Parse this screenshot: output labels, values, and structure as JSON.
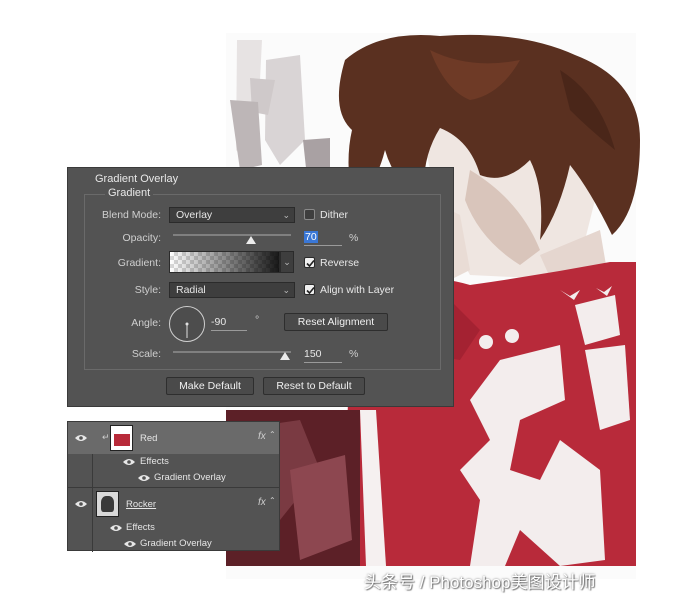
{
  "gradient_overlay": {
    "title": "Gradient Overlay",
    "group_title": "Gradient",
    "blend_mode": {
      "label": "Blend Mode:",
      "value": "Overlay"
    },
    "dither": {
      "label": "Dither",
      "checked": false
    },
    "opacity": {
      "label": "Opacity:",
      "value": "70",
      "unit": "%"
    },
    "gradient": {
      "label": "Gradient:"
    },
    "reverse": {
      "label": "Reverse",
      "checked": true
    },
    "style": {
      "label": "Style:",
      "value": "Radial"
    },
    "align_with_layer": {
      "label": "Align with Layer",
      "checked": true
    },
    "angle": {
      "label": "Angle:",
      "value": "-90",
      "unit": "°"
    },
    "reset_alignment": "Reset Alignment",
    "scale": {
      "label": "Scale:",
      "value": "150",
      "unit": "%"
    },
    "make_default": "Make Default",
    "reset_to_default": "Reset to Default"
  },
  "layers": [
    {
      "name": "Red",
      "effects_label": "Effects",
      "effect": "Gradient Overlay",
      "fx": "fx",
      "selected": true
    },
    {
      "name": "Rocker",
      "effects_label": "Effects",
      "effect": "Gradient Overlay",
      "fx": "fx",
      "selected": false
    }
  ],
  "watermark": "头条号 / Photoshop美图设计师",
  "colors": {
    "shirt_red": "#b82a3a",
    "hair_brown": "#5a3020",
    "panel_bg": "#535353",
    "selection_blue": "#3a77d6"
  }
}
